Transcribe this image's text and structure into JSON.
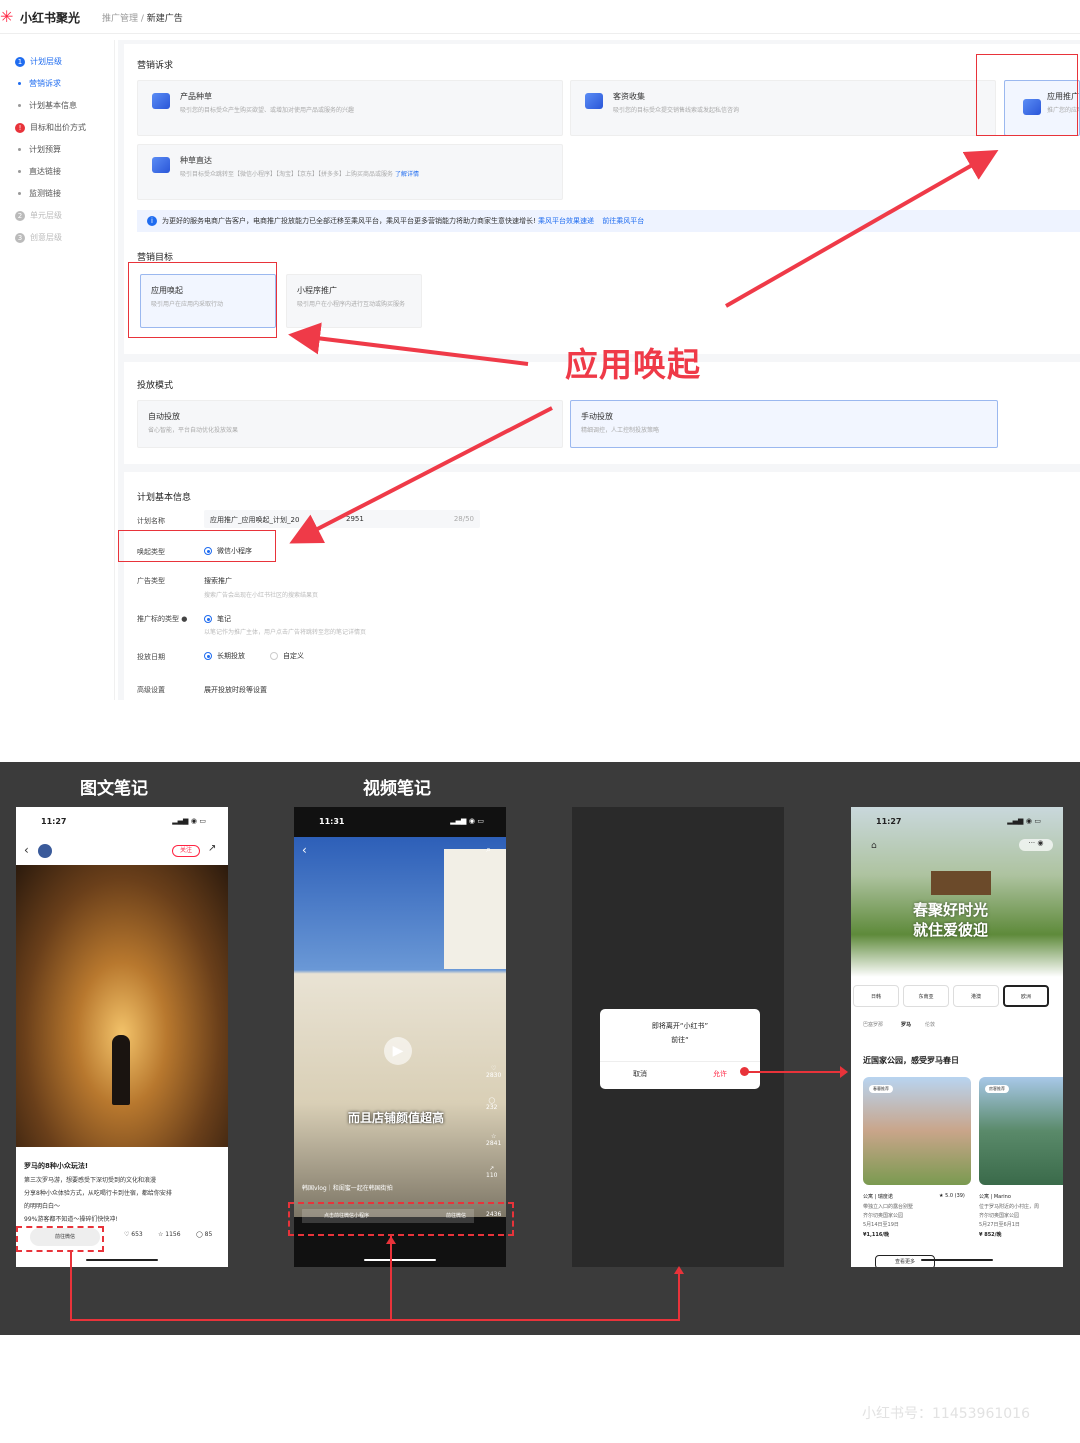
{
  "header": {
    "app_title": "小红书聚光",
    "breadcrumb_parent": "推广管理",
    "breadcrumb_sep": " / ",
    "breadcrumb_current": "新建广告"
  },
  "sidebar": {
    "items": [
      {
        "label": "计划层级",
        "marker": "1"
      },
      {
        "label": "营销诉求"
      },
      {
        "label": "计划基本信息"
      },
      {
        "label": "目标和出价方式",
        "marker": "!"
      },
      {
        "label": "计划预算"
      },
      {
        "label": "直达链接"
      },
      {
        "label": "监测链接"
      },
      {
        "label": "单元层级",
        "marker": "2"
      },
      {
        "label": "创意层级",
        "marker": "3"
      }
    ]
  },
  "marketing": {
    "title": "营销诉求",
    "cards": [
      {
        "title": "产品种草",
        "desc": "吸引您的目标受众产生购买欲望、或增加对使用产品或服务的兴趣"
      },
      {
        "title": "客资收集",
        "desc": "吸引您的目标受众提交销售线索或发起私信咨询"
      },
      {
        "title": "应用推广",
        "desc": "推广您的应用"
      },
      {
        "title": "种草直达",
        "desc": "吸引目标受众跳转至【微信小程序】【淘宝】【京东】【拼多多】上购买商品或服务",
        "link": "了解详情"
      }
    ],
    "notice": "为更好的服务电商广告客户，电商推广投放能力已全部迁移至乘风平台，乘风平台更多营销能力将助力商家生意快速增长!",
    "notice_link1": "乘风平台效果速递",
    "notice_link2": "前往乘风平台"
  },
  "goal": {
    "title": "营销目标",
    "cards": [
      {
        "title": "应用唤起",
        "desc": "吸引用户在应用内采取行动"
      },
      {
        "title": "小程序推广",
        "desc": "吸引用户在小程序内进行互动或购买服务"
      }
    ]
  },
  "callout": "应用唤起",
  "mode": {
    "title": "投放模式",
    "cards": [
      {
        "title": "自动投放",
        "desc": "省心智能，平台自动优化投放效果"
      },
      {
        "title": "手动投放",
        "desc": "精细调控，人工控制投放策略"
      }
    ]
  },
  "plan": {
    "title": "计划基本信息",
    "rows": {
      "name_label": "计划名称",
      "name_value": "应用推广_应用唤起_计划_20",
      "name_suffix": "2951",
      "name_count": "28/50",
      "invoke_label": "唤起类型",
      "invoke_value": "微信小程序",
      "adtype_label": "广告类型",
      "adtype_value": "搜索推广",
      "adtype_hint": "搜索广告会出现在小红书社区的搜索结果页",
      "target_label": "推广标的类型",
      "target_value": "笔记",
      "target_hint": "以笔记作为推广主体，用户点击广告将跳转至您的笔记详情页",
      "date_label": "投放日期",
      "date_opt1": "长期投放",
      "date_opt2": "自定义",
      "adv_label": "高级设置",
      "adv_link": "展开投放时段等设置"
    }
  },
  "bottom": {
    "heading_left": "图文笔记",
    "heading_mid": "视频笔记",
    "phone1": {
      "time": "11:27",
      "follow": "关注",
      "title_line": "罗马的8种小众玩法!",
      "body1": "第三次罗马游，想要感受下深切受到的文化和浪漫",
      "body2": "分享8种小众体验方式，从吃喝行卡到住宿，都给你安排",
      "body3": "的明明白白～",
      "body4": "99%游客都不知道～操碎们快快冲!",
      "cta": "前往微信",
      "likes": "653",
      "stars": "1156",
      "comments": "85"
    },
    "phone2": {
      "time": "11:31",
      "caption": "而且店铺颜值超高",
      "desc": "韩国vlog｜和闺蜜一起在韩国街拍",
      "bar_text": "点击前往微信小程序",
      "bar_btn": "前往微信",
      "count1": "2830",
      "count2": "232",
      "count3": "2841",
      "count4": "110",
      "count5": "2436"
    },
    "dialog": {
      "line1": "即将离开“小红书”",
      "line2": "前往“",
      "cancel": "取消",
      "allow": "允许"
    },
    "phone4": {
      "time": "11:27",
      "banner1": "春聚好时光",
      "banner2": "就住爱彼迎",
      "tabs": [
        "日韩",
        "东南亚",
        "港澳",
        "欧洲"
      ],
      "subtabs": [
        "巴塞罗那",
        "罗马",
        "伦敦"
      ],
      "section": "近国家公园，感受罗马春日",
      "l1_tag": "春暮推荐",
      "l1_type": "公寓 | 瑞度诺",
      "l1_rating": "★ 5.0 (39)",
      "l1_desc1": "带独立入口的露台别墅",
      "l1_desc2": "齐尔切奥国家公园",
      "l1_dates": "5月14日至19日",
      "l1_price": "¥1,116/晚",
      "l2_tag": "房客推荐",
      "l2_type": "公寓 | Marino",
      "l2_desc1": "位于罗马附近的小村庄，周",
      "l2_desc2": "齐尔切奥国家公园",
      "l2_dates": "5月27日至6月1日",
      "l2_price": "¥ 852/晚",
      "more_btn": "查看更多"
    }
  },
  "watermark": "小红书号：11453961016"
}
